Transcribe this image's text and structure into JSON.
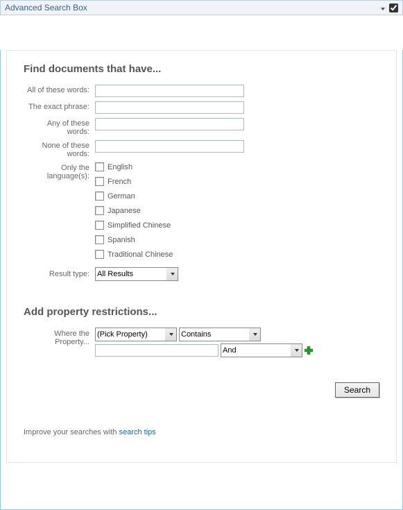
{
  "titlebar": {
    "title": "Advanced Search Box",
    "dropdown_expanded": false,
    "checkbox_checked": true
  },
  "section1": {
    "heading": "Find documents that have...",
    "labels": {
      "all_words": "All of these words:",
      "exact_phrase": "The exact phrase:",
      "any_words": "Any of these words:",
      "none_words": "None of these words:",
      "languages": "Only the language(s):",
      "result_type": "Result type:"
    },
    "values": {
      "all_words": "",
      "exact_phrase": "",
      "any_words": "",
      "none_words": ""
    },
    "languages": [
      {
        "label": "English",
        "checked": false
      },
      {
        "label": "French",
        "checked": false
      },
      {
        "label": "German",
        "checked": false
      },
      {
        "label": "Japanese",
        "checked": false
      },
      {
        "label": "Simplified Chinese",
        "checked": false
      },
      {
        "label": "Spanish",
        "checked": false
      },
      {
        "label": "Traditional Chinese",
        "checked": false
      }
    ],
    "result_type": {
      "selected": "All Results"
    }
  },
  "section2": {
    "heading": "Add property restrictions...",
    "label": "Where the Property...",
    "property_select": {
      "selected": "(Pick Property)"
    },
    "operator_select": {
      "selected": "Contains"
    },
    "value_input": "",
    "logic_select": {
      "selected": "And"
    }
  },
  "search_button_label": "Search",
  "tips": {
    "prefix": "Improve your searches with ",
    "link": "search tips"
  },
  "colors": {
    "title_text": "#3b5c7f",
    "border_outer": "#99c6ec",
    "link": "#1a66b3",
    "plus_green": "#2e9b2e"
  }
}
